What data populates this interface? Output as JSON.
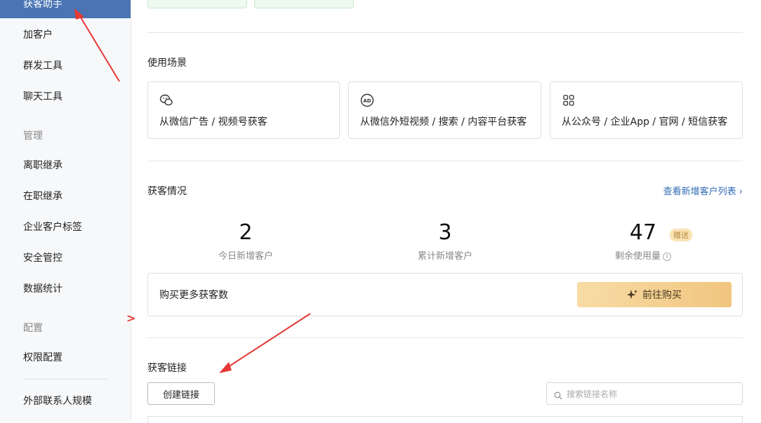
{
  "sidebar": {
    "items": [
      {
        "label": "获客助手",
        "active": true
      },
      {
        "label": "加客户"
      },
      {
        "label": "群发工具"
      },
      {
        "label": "聊天工具"
      }
    ],
    "group_manage": "管理",
    "manage_items": [
      {
        "label": "离职继承"
      },
      {
        "label": "在职继承"
      },
      {
        "label": "企业客户标签"
      },
      {
        "label": "安全管控"
      },
      {
        "label": "数据统计"
      }
    ],
    "group_config": "配置",
    "config_items": [
      {
        "label": "权限配置"
      }
    ],
    "bottom_item": "外部联系人规模"
  },
  "scenes": {
    "title": "使用场景",
    "cards": [
      {
        "icon": "wechat-icon",
        "label": "从微信广告 / 视频号获客"
      },
      {
        "icon": "ad-icon",
        "label": "从微信外短视频 / 搜索 / 内容平台获客"
      },
      {
        "icon": "apps-grid-icon",
        "label": "从公众号 / 企业App / 官网 / 短信获客"
      }
    ]
  },
  "stats": {
    "title": "获客情况",
    "link": "查看新增客户列表",
    "items": [
      {
        "value": "2",
        "label": "今日新增客户"
      },
      {
        "value": "3",
        "label": "累计新增客户"
      },
      {
        "value": "47",
        "label": "剩余使用量",
        "badge": "赠送"
      }
    ],
    "buy_label": "购买更多获客数",
    "buy_button": "前往购买"
  },
  "links": {
    "title": "获客链接",
    "create_button": "创建链接",
    "search_placeholder": "搜索链接名称"
  },
  "colors": {
    "sidebar_active": "#4a74b4",
    "link": "#2f6bb5",
    "annotation": "#e53935"
  }
}
